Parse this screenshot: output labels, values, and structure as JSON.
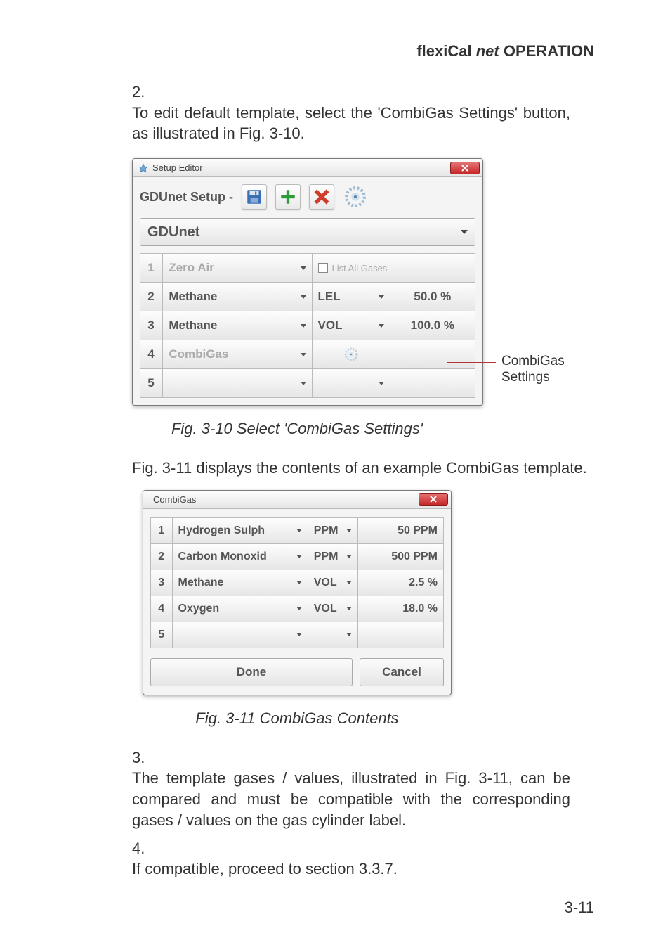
{
  "header": {
    "brand": "flexiCal ",
    "brand_italic": "net",
    "rest": " OPERATION"
  },
  "para1_num": "2.",
  "para1": "To edit default template, select the 'CombiGas Settings' button, as illustrated in Fig. 3-10.",
  "setup_editor": {
    "title": "Setup Editor",
    "toolbar_label": "GDUnet Setup -",
    "profile": "GDUnet",
    "rows": [
      {
        "n": "1",
        "gas": "Zero Air",
        "mid_type": "checkbox",
        "mid_label": "List All Gases",
        "val": "",
        "disabled": true
      },
      {
        "n": "2",
        "gas": "Methane",
        "mid_type": "select",
        "mid_label": "LEL",
        "val": "50.0 %"
      },
      {
        "n": "3",
        "gas": "Methane",
        "mid_type": "select",
        "mid_label": "VOL",
        "val": "100.0 %"
      },
      {
        "n": "4",
        "gas": "CombiGas",
        "mid_type": "gear",
        "mid_label": "",
        "val": "",
        "disabled": true
      },
      {
        "n": "5",
        "gas": "",
        "mid_type": "blank",
        "mid_label": "",
        "val": ""
      }
    ]
  },
  "callout": {
    "l1": "CombiGas",
    "l2": "Settings"
  },
  "caption310": "Fig. 3-10  Select 'CombiGas Settings'",
  "para2": "Fig. 3-11 displays the contents of an example CombiGas template.",
  "combigas": {
    "title": "CombiGas",
    "rows": [
      {
        "n": "1",
        "gas": "Hydrogen Sulph",
        "unit": "PPM",
        "val": "50 PPM"
      },
      {
        "n": "2",
        "gas": "Carbon Monoxid",
        "unit": "PPM",
        "val": "500 PPM"
      },
      {
        "n": "3",
        "gas": "Methane",
        "unit": "VOL",
        "val": "2.5 %"
      },
      {
        "n": "4",
        "gas": "Oxygen",
        "unit": "VOL",
        "val": "18.0 %"
      },
      {
        "n": "5",
        "gas": "",
        "unit": "",
        "val": ""
      }
    ],
    "done": "Done",
    "cancel": "Cancel"
  },
  "caption311": "Fig. 3-11  CombiGas Contents",
  "para3_num": "3.",
  "para3": "The template gases / values, illustrated in Fig. 3-11, can be compared and must be compatible with the corresponding gases / values on the gas cylinder label.",
  "para4_num": "4.",
  "para4": "If compatible, proceed to section 3.3.7.",
  "page_no": "3-11"
}
